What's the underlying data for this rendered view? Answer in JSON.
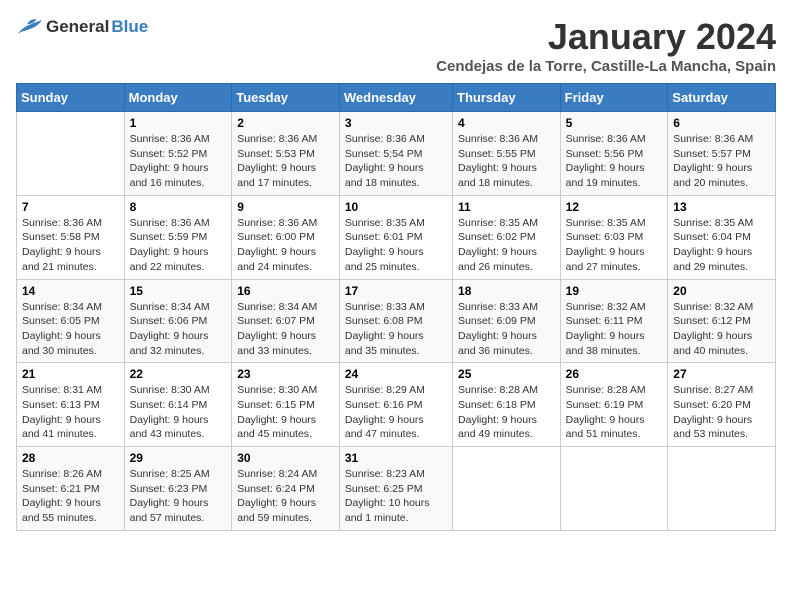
{
  "header": {
    "logo": {
      "general": "General",
      "blue": "Blue"
    },
    "title": "January 2024",
    "subtitle": "Cendejas de la Torre, Castille-La Mancha, Spain"
  },
  "calendar": {
    "days_of_week": [
      "Sunday",
      "Monday",
      "Tuesday",
      "Wednesday",
      "Thursday",
      "Friday",
      "Saturday"
    ],
    "weeks": [
      [
        {
          "day": "",
          "info": ""
        },
        {
          "day": "1",
          "info": "Sunrise: 8:36 AM\nSunset: 5:52 PM\nDaylight: 9 hours\nand 16 minutes."
        },
        {
          "day": "2",
          "info": "Sunrise: 8:36 AM\nSunset: 5:53 PM\nDaylight: 9 hours\nand 17 minutes."
        },
        {
          "day": "3",
          "info": "Sunrise: 8:36 AM\nSunset: 5:54 PM\nDaylight: 9 hours\nand 18 minutes."
        },
        {
          "day": "4",
          "info": "Sunrise: 8:36 AM\nSunset: 5:55 PM\nDaylight: 9 hours\nand 18 minutes."
        },
        {
          "day": "5",
          "info": "Sunrise: 8:36 AM\nSunset: 5:56 PM\nDaylight: 9 hours\nand 19 minutes."
        },
        {
          "day": "6",
          "info": "Sunrise: 8:36 AM\nSunset: 5:57 PM\nDaylight: 9 hours\nand 20 minutes."
        }
      ],
      [
        {
          "day": "7",
          "info": "Sunrise: 8:36 AM\nSunset: 5:58 PM\nDaylight: 9 hours\nand 21 minutes."
        },
        {
          "day": "8",
          "info": "Sunrise: 8:36 AM\nSunset: 5:59 PM\nDaylight: 9 hours\nand 22 minutes."
        },
        {
          "day": "9",
          "info": "Sunrise: 8:36 AM\nSunset: 6:00 PM\nDaylight: 9 hours\nand 24 minutes."
        },
        {
          "day": "10",
          "info": "Sunrise: 8:35 AM\nSunset: 6:01 PM\nDaylight: 9 hours\nand 25 minutes."
        },
        {
          "day": "11",
          "info": "Sunrise: 8:35 AM\nSunset: 6:02 PM\nDaylight: 9 hours\nand 26 minutes."
        },
        {
          "day": "12",
          "info": "Sunrise: 8:35 AM\nSunset: 6:03 PM\nDaylight: 9 hours\nand 27 minutes."
        },
        {
          "day": "13",
          "info": "Sunrise: 8:35 AM\nSunset: 6:04 PM\nDaylight: 9 hours\nand 29 minutes."
        }
      ],
      [
        {
          "day": "14",
          "info": "Sunrise: 8:34 AM\nSunset: 6:05 PM\nDaylight: 9 hours\nand 30 minutes."
        },
        {
          "day": "15",
          "info": "Sunrise: 8:34 AM\nSunset: 6:06 PM\nDaylight: 9 hours\nand 32 minutes."
        },
        {
          "day": "16",
          "info": "Sunrise: 8:34 AM\nSunset: 6:07 PM\nDaylight: 9 hours\nand 33 minutes."
        },
        {
          "day": "17",
          "info": "Sunrise: 8:33 AM\nSunset: 6:08 PM\nDaylight: 9 hours\nand 35 minutes."
        },
        {
          "day": "18",
          "info": "Sunrise: 8:33 AM\nSunset: 6:09 PM\nDaylight: 9 hours\nand 36 minutes."
        },
        {
          "day": "19",
          "info": "Sunrise: 8:32 AM\nSunset: 6:11 PM\nDaylight: 9 hours\nand 38 minutes."
        },
        {
          "day": "20",
          "info": "Sunrise: 8:32 AM\nSunset: 6:12 PM\nDaylight: 9 hours\nand 40 minutes."
        }
      ],
      [
        {
          "day": "21",
          "info": "Sunrise: 8:31 AM\nSunset: 6:13 PM\nDaylight: 9 hours\nand 41 minutes."
        },
        {
          "day": "22",
          "info": "Sunrise: 8:30 AM\nSunset: 6:14 PM\nDaylight: 9 hours\nand 43 minutes."
        },
        {
          "day": "23",
          "info": "Sunrise: 8:30 AM\nSunset: 6:15 PM\nDaylight: 9 hours\nand 45 minutes."
        },
        {
          "day": "24",
          "info": "Sunrise: 8:29 AM\nSunset: 6:16 PM\nDaylight: 9 hours\nand 47 minutes."
        },
        {
          "day": "25",
          "info": "Sunrise: 8:28 AM\nSunset: 6:18 PM\nDaylight: 9 hours\nand 49 minutes."
        },
        {
          "day": "26",
          "info": "Sunrise: 8:28 AM\nSunset: 6:19 PM\nDaylight: 9 hours\nand 51 minutes."
        },
        {
          "day": "27",
          "info": "Sunrise: 8:27 AM\nSunset: 6:20 PM\nDaylight: 9 hours\nand 53 minutes."
        }
      ],
      [
        {
          "day": "28",
          "info": "Sunrise: 8:26 AM\nSunset: 6:21 PM\nDaylight: 9 hours\nand 55 minutes."
        },
        {
          "day": "29",
          "info": "Sunrise: 8:25 AM\nSunset: 6:23 PM\nDaylight: 9 hours\nand 57 minutes."
        },
        {
          "day": "30",
          "info": "Sunrise: 8:24 AM\nSunset: 6:24 PM\nDaylight: 9 hours\nand 59 minutes."
        },
        {
          "day": "31",
          "info": "Sunrise: 8:23 AM\nSunset: 6:25 PM\nDaylight: 10 hours\nand 1 minute."
        },
        {
          "day": "",
          "info": ""
        },
        {
          "day": "",
          "info": ""
        },
        {
          "day": "",
          "info": ""
        }
      ]
    ]
  }
}
